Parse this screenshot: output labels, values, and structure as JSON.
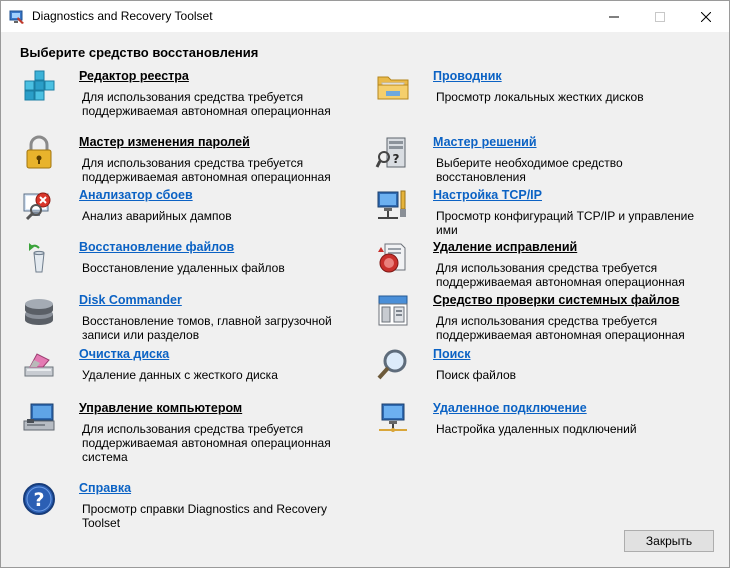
{
  "window": {
    "title": "Diagnostics and Recovery Toolset"
  },
  "heading": "Выберите средство восстановления",
  "tools": [
    {
      "name": "Редактор реестра",
      "description": "Для использования средства требуется поддерживаемая автономная операционная система",
      "icon": "registry-cubes-icon"
    },
    {
      "name": "Мастер изменения паролей",
      "description": "Для использования средства требуется поддерживаемая автономная операционная",
      "icon": "padlock-icon"
    },
    {
      "name": "Анализатор сбоев",
      "description": "Анализ аварийных дампов",
      "icon": "crash-monitor-icon"
    },
    {
      "name": "Восстановление файлов",
      "description": "Восстановление удаленных файлов",
      "icon": "recycle-bin-icon"
    },
    {
      "name": "Disk Commander",
      "description": "Восстановление томов, главной загрузочной записи или разделов",
      "icon": "disk-stack-icon"
    },
    {
      "name": "Очистка диска",
      "description": "Удаление данных с жесткого диска",
      "icon": "eraser-icon"
    },
    {
      "name": "Управление компьютером",
      "description": "Для использования средства требуется поддерживаемая автономная операционная система",
      "icon": "computer-management-icon"
    },
    {
      "name": "Справка",
      "description": "Просмотр справки Diagnostics and Recovery Toolset",
      "icon": "help-icon"
    },
    {
      "name": "Проводник",
      "description": "Просмотр локальных жестких дисков",
      "icon": "folder-icon"
    },
    {
      "name": "Мастер решений",
      "description": "Выберите необходимое средство восстановления",
      "icon": "solution-wizard-icon"
    },
    {
      "name": "Настройка TCP/IP",
      "description": "Просмотр конфигураций TCP/IP и управление ими",
      "icon": "network-config-icon"
    },
    {
      "name": "Удаление исправлений",
      "description": "Для использования средства требуется поддерживаемая автономная операционная",
      "icon": "hotfix-uninstall-icon"
    },
    {
      "name": "Средство проверки системных файлов",
      "description": "Для использования средства требуется поддерживаемая автономная операционная",
      "icon": "system-file-checker-icon"
    },
    {
      "name": "Поиск",
      "description": "Поиск файлов",
      "icon": "search-icon"
    },
    {
      "name": "Удаленное подключение",
      "description": "Настройка удаленных подключений",
      "icon": "remote-connection-icon"
    }
  ],
  "buttons": {
    "close": "Закрыть"
  }
}
